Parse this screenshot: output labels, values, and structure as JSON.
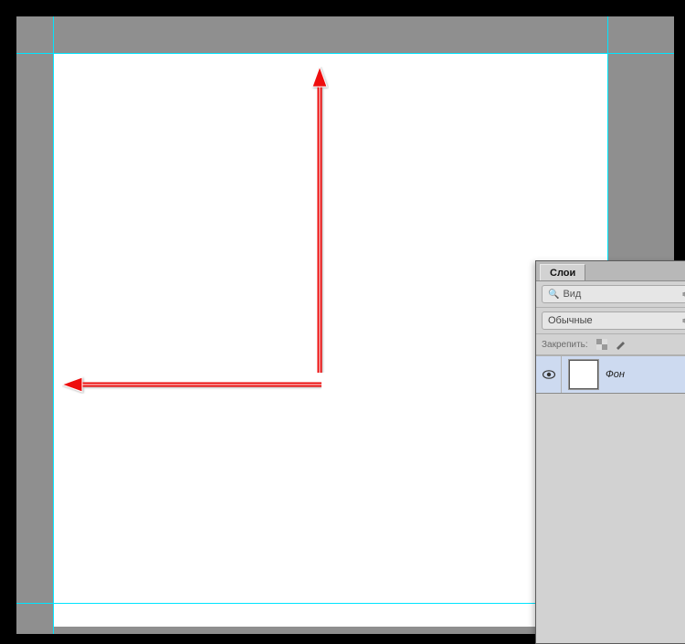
{
  "layersPanel": {
    "tabLabel": "Слои",
    "kindFilterLabel": "Вид",
    "blendModeLabel": "Обычные",
    "lockLabel": "Закрепить:",
    "layer": {
      "name": "Фон"
    }
  }
}
